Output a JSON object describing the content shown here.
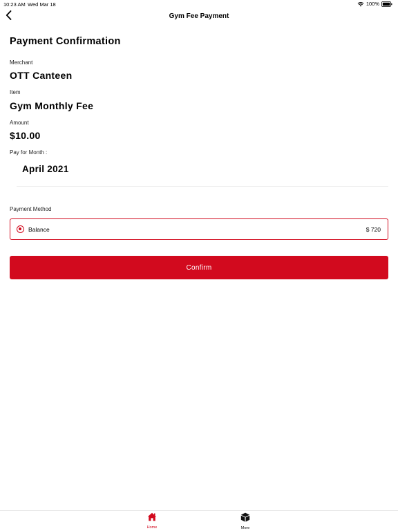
{
  "status_bar": {
    "time": "10:23 AM",
    "date": "Wed Mar 18",
    "battery": "100%"
  },
  "nav": {
    "title": "Gym Fee Payment",
    "back_icon": "chevron-left-icon"
  },
  "confirmation": {
    "title": "Payment Confirmation",
    "merchant_label": "Merchant",
    "merchant_value": "OTT Canteen",
    "item_label": "Item",
    "item_value": "Gym Monthly Fee",
    "amount_label": "Amount",
    "amount_value": "$10.00",
    "month_label": "Pay for Month :",
    "month_value": "April 2021"
  },
  "payment_method": {
    "label": "Payment Method",
    "option_label": "Balance",
    "option_amount": "$ 720",
    "selected": true
  },
  "confirm_button": {
    "label": "Confirm"
  },
  "tab_bar": {
    "items": [
      {
        "label": "Home",
        "icon": "home-icon",
        "active": true
      },
      {
        "label": "More",
        "icon": "cube-icon",
        "active": false
      }
    ]
  },
  "colors": {
    "accent": "#d20a1e",
    "border": "#ececec"
  }
}
